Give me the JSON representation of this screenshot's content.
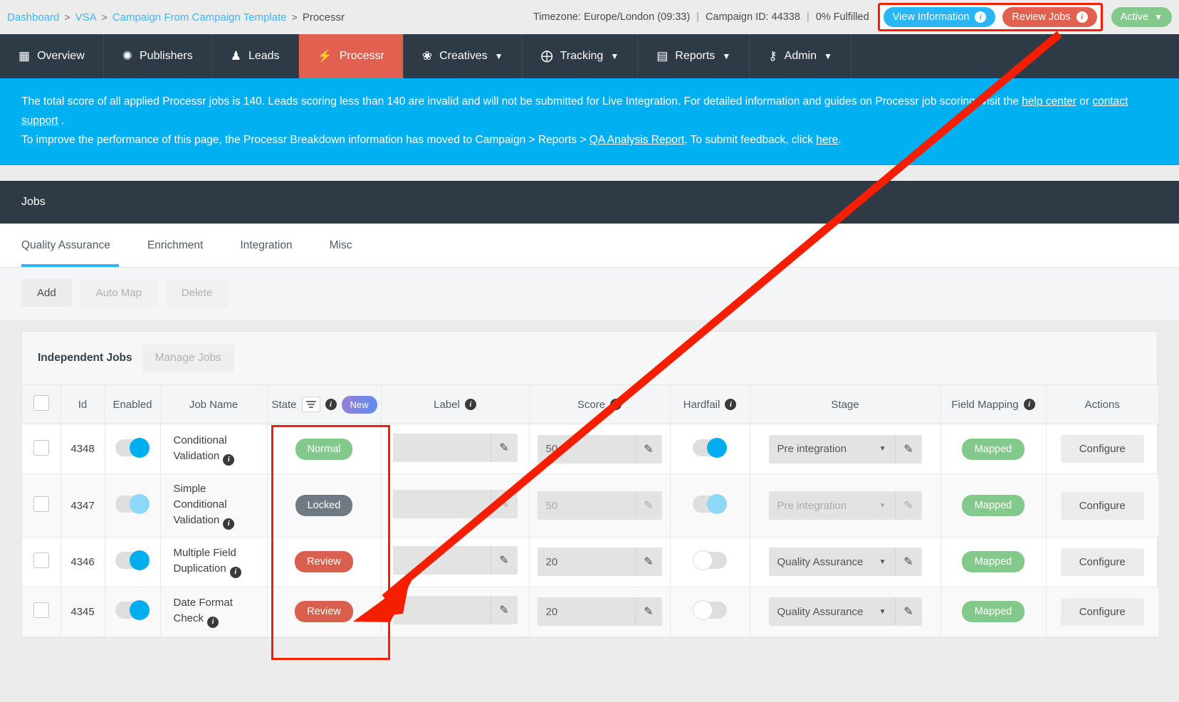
{
  "breadcrumb": {
    "items": [
      {
        "label": "Dashboard",
        "link": true
      },
      {
        "label": "VSA",
        "link": true
      },
      {
        "label": "Campaign From Campaign Template",
        "link": true
      },
      {
        "label": "Processr",
        "link": false
      }
    ],
    "sep": ">"
  },
  "header": {
    "timezone": "Timezone: Europe/London (09:33)",
    "campaign_id": "Campaign ID: 44338",
    "fulfilled": "0% Fulfilled",
    "pipe": "|",
    "view_information": "View Information",
    "review_jobs": "Review Jobs",
    "status": "Active",
    "info_glyph": "i",
    "caret": "♥"
  },
  "nav": {
    "items": [
      {
        "label": "Overview",
        "icon": "☷",
        "icon_name": "chart-icon",
        "caret": false,
        "active": false
      },
      {
        "label": "Publishers",
        "icon": "✺",
        "icon_name": "publishers-icon",
        "caret": false,
        "active": false
      },
      {
        "label": "Leads",
        "icon": "♟",
        "icon_name": "person-icon",
        "caret": false,
        "active": false
      },
      {
        "label": "Processr",
        "icon": "⚡",
        "icon_name": "bolt-icon",
        "caret": false,
        "active": true
      },
      {
        "label": "Creatives",
        "icon": "❀",
        "icon_name": "palette-icon",
        "caret": true,
        "active": false
      },
      {
        "label": "Tracking",
        "icon": "⊕",
        "icon_name": "target-icon",
        "caret": true,
        "active": false
      },
      {
        "label": "Reports",
        "icon": "▤",
        "icon_name": "document-icon",
        "caret": true,
        "active": false
      },
      {
        "label": "Admin",
        "icon": "⚷",
        "icon_name": "key-icon",
        "caret": true,
        "active": false
      }
    ],
    "caret_glyph": "▾"
  },
  "banner": {
    "line1_a": "The total score of all applied Processr jobs is 140. Leads scoring less than 140 are invalid and will not be submitted for Live Integration. For detailed information and guides on Processr job scoring, visit the ",
    "line1_link1": "help center",
    "line1_b": " or ",
    "line1_link2": "contact support",
    "line1_c": " .",
    "line2_a": "To improve the performance of this page, the Processr Breakdown information has moved to Campaign > Reports > ",
    "line2_link1": "QA Analysis Report",
    "line2_b": ". To submit feedback, click ",
    "line2_link2": "here",
    "line2_c": "."
  },
  "jobs": {
    "title": "Jobs",
    "tabs": [
      {
        "label": "Quality Assurance",
        "active": true
      },
      {
        "label": "Enrichment",
        "active": false
      },
      {
        "label": "Integration",
        "active": false
      },
      {
        "label": "Misc",
        "active": false
      }
    ],
    "toolbar": [
      {
        "label": "Add",
        "disabled": false
      },
      {
        "label": "Auto Map",
        "disabled": true
      },
      {
        "label": "Delete",
        "disabled": true
      }
    ],
    "panel_tabs": {
      "independent": "Independent Jobs",
      "manage": "Manage Jobs"
    },
    "columns": [
      {
        "label": "",
        "name": "select-all"
      },
      {
        "label": "Id",
        "name": "id"
      },
      {
        "label": "Enabled",
        "name": "enabled"
      },
      {
        "label": "Job Name",
        "name": "job-name"
      },
      {
        "label": "State",
        "name": "state",
        "filter": true,
        "info": true,
        "badge": "New"
      },
      {
        "label": "Label",
        "name": "label",
        "info": true
      },
      {
        "label": "Score",
        "name": "score",
        "info": true
      },
      {
        "label": "Hardfail",
        "name": "hardfail",
        "info": true
      },
      {
        "label": "Stage",
        "name": "stage"
      },
      {
        "label": "Field Mapping",
        "name": "field-mapping",
        "info": true
      },
      {
        "label": "Actions",
        "name": "actions"
      }
    ],
    "rows": [
      {
        "id": "4348",
        "enabled": true,
        "enabled_style": "on",
        "name": "Conditional Validation",
        "state": "Normal",
        "state_style": "normal",
        "label_value": "",
        "score": "50",
        "hardfail": true,
        "hardfail_style": "on",
        "stage": "Pre integration",
        "field_mapping": "Mapped",
        "action": "Configure",
        "dim": false
      },
      {
        "id": "4347",
        "enabled": true,
        "enabled_style": "faded",
        "name": "Simple Conditional Validation",
        "state": "Locked",
        "state_style": "locked",
        "label_value": "",
        "score": "50",
        "hardfail": true,
        "hardfail_style": "faded",
        "stage": "Pre integration",
        "field_mapping": "Mapped",
        "action": "Configure",
        "dim": true
      },
      {
        "id": "4346",
        "enabled": true,
        "enabled_style": "on",
        "name": "Multiple Field Duplication",
        "state": "Review",
        "state_style": "review",
        "label_value": "",
        "score": "20",
        "hardfail": false,
        "hardfail_style": "off",
        "stage": "Quality Assurance",
        "field_mapping": "Mapped",
        "action": "Configure",
        "dim": false
      },
      {
        "id": "4345",
        "enabled": true,
        "enabled_style": "on",
        "name": "Date Format Check",
        "state": "Review",
        "state_style": "review",
        "label_value": "",
        "score": "20",
        "hardfail": false,
        "hardfail_style": "off",
        "stage": "Quality Assurance",
        "field_mapping": "Mapped",
        "action": "Configure",
        "dim": false
      }
    ],
    "pencil_glyph": "✎",
    "down_glyph": "▼"
  },
  "annotation": {
    "color": "#f51e00"
  }
}
